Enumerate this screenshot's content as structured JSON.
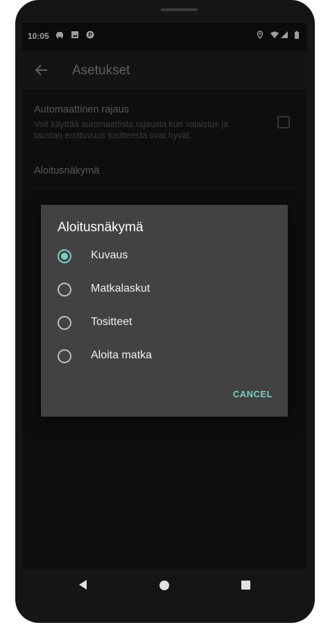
{
  "status_bar": {
    "time": "10:05",
    "left_icons": [
      "car-icon",
      "image-icon",
      "app-badge-icon"
    ],
    "right_icons": [
      "location-icon",
      "wifi-icon",
      "signal-icon",
      "battery-icon"
    ]
  },
  "app_bar": {
    "title": "Asetukset",
    "back_icon": "arrow-left-icon"
  },
  "settings": {
    "auto_crop": {
      "title": "Automaattinen rajaus",
      "summary": "Voit käyttää automaattista rajausta kun valaistus ja taustan erottuvuus tositteesta ovat hyvät.",
      "checked": false
    },
    "start_view": {
      "title": "Aloitusnäkymä"
    }
  },
  "dialog": {
    "title": "Aloitusnäkymä",
    "options": [
      {
        "label": "Kuvaus",
        "selected": true
      },
      {
        "label": "Matkalaskut",
        "selected": false
      },
      {
        "label": "Tositteet",
        "selected": false
      },
      {
        "label": "Aloita matka",
        "selected": false
      }
    ],
    "cancel_label": "CANCEL"
  },
  "colors": {
    "accent": "#7ad0bf",
    "dialog_bg": "#424242",
    "app_bar_bg": "#212121"
  }
}
